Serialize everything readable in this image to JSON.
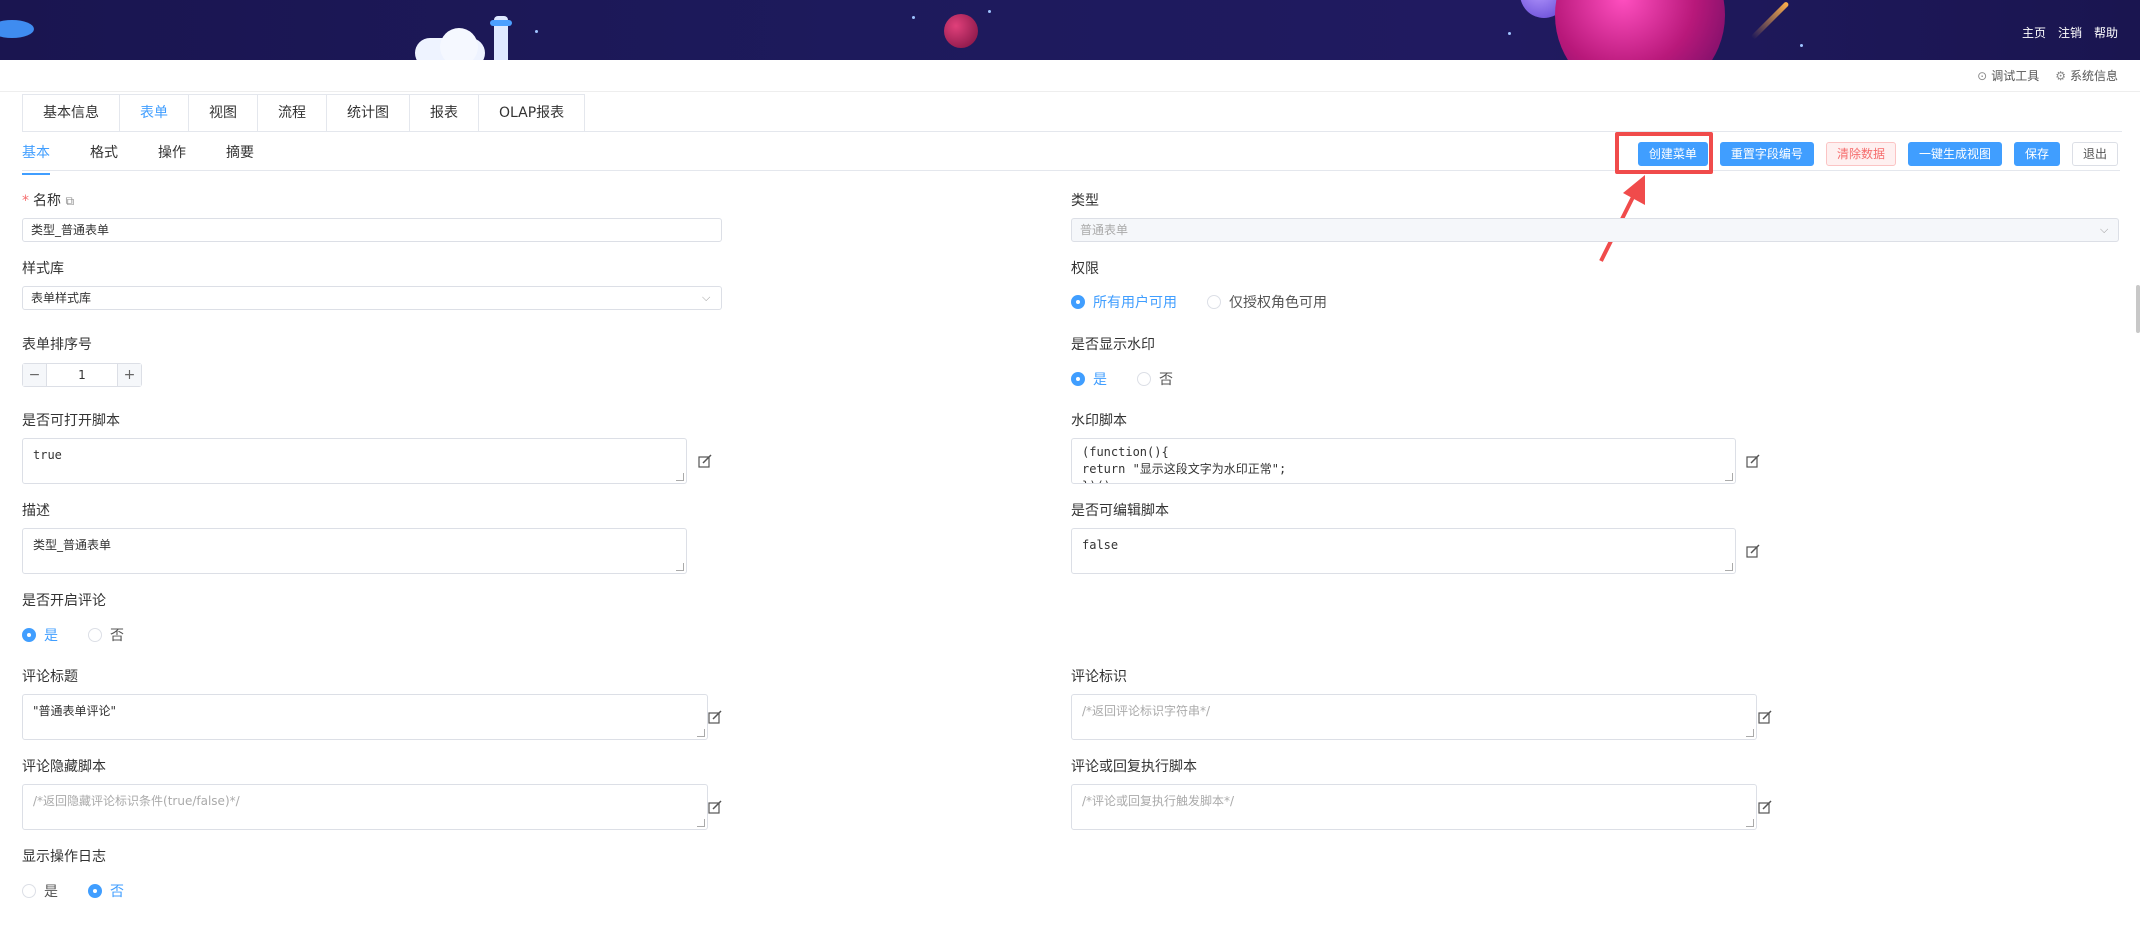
{
  "topnav": {
    "home": "主页",
    "logout": "注销",
    "help": "帮助"
  },
  "subheader": {
    "debug_tool": "调试工具",
    "system_info": "系统信息"
  },
  "tabs_top": [
    "基本信息",
    "表单",
    "视图",
    "流程",
    "统计图",
    "报表",
    "OLAP报表"
  ],
  "tabs_sub": [
    "基本",
    "格式",
    "操作",
    "摘要"
  ],
  "actions": {
    "create_menu": "创建菜单",
    "reset_field_no": "重置字段编号",
    "clear_data": "清除数据",
    "generate_view": "一键生成视图",
    "save": "保存",
    "exit": "退出"
  },
  "form": {
    "name_label": "名称",
    "name_value": "类型_普通表单",
    "type_label": "类型",
    "type_value": "普通表单",
    "style_label": "样式库",
    "style_value": "表单样式库",
    "permission_label": "权限",
    "permission_all": "所有用户可用",
    "permission_role": "仅授权角色可用",
    "sort_label": "表单排序号",
    "sort_value": "1",
    "watermark_label": "是否显示水印",
    "yes": "是",
    "no": "否",
    "open_script_label": "是否可打开脚本",
    "open_script_value": "true",
    "watermark_script_label": "水印脚本",
    "watermark_script_value": "(function(){\nreturn \"显示这段文字为水印正常\";\n})();",
    "desc_label": "描述",
    "desc_value": "类型_普通表单",
    "editable_script_label": "是否可编辑脚本",
    "editable_script_value": "false",
    "comment_enable_label": "是否开启评论",
    "comment_title_label": "评论标题",
    "comment_title_value": "\"普通表单评论\"",
    "comment_id_label": "评论标识",
    "comment_id_placeholder": "/*返回评论标识字符串*/",
    "comment_hide_label": "评论隐藏脚本",
    "comment_hide_placeholder": "/*返回隐藏评论标识条件(true/false)*/",
    "comment_exec_label": "评论或回复执行脚本",
    "comment_exec_placeholder": "/*评论或回复执行触发脚本*/",
    "show_log_label": "显示操作日志"
  },
  "colors": {
    "primary": "#409eff",
    "danger": "#f56c6c",
    "banner": "#1d1a5c",
    "highlight": "#f04b4b"
  }
}
